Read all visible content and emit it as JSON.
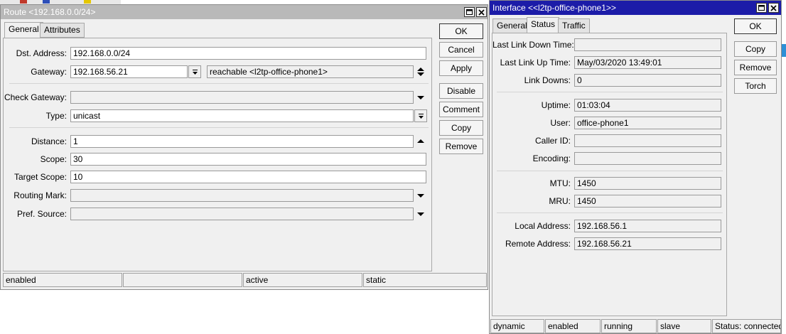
{
  "route_window": {
    "title": "Route <192.168.0.0/24>",
    "tabs": [
      "General",
      "Attributes"
    ],
    "labels": {
      "dst_address": "Dst. Address:",
      "gateway": "Gateway:",
      "check_gateway": "Check Gateway:",
      "type": "Type:",
      "distance": "Distance:",
      "scope": "Scope:",
      "target_scope": "Target Scope:",
      "routing_mark": "Routing Mark:",
      "pref_source": "Pref. Source:"
    },
    "values": {
      "dst_address": "192.168.0.0/24",
      "gateway": "192.168.56.21",
      "gateway_status": "reachable <l2tp-office-phone1>",
      "check_gateway": "",
      "type": "unicast",
      "distance": "1",
      "scope": "30",
      "target_scope": "10",
      "routing_mark": "",
      "pref_source": ""
    },
    "buttons": [
      "OK",
      "Cancel",
      "Apply",
      "Disable",
      "Comment",
      "Copy",
      "Remove"
    ],
    "status_bar": [
      "enabled",
      "",
      "active",
      "static"
    ]
  },
  "interface_window": {
    "title": "Interface <<l2tp-office-phone1>>",
    "tabs": [
      "General",
      "Status",
      "Traffic"
    ],
    "labels": {
      "last_link_down_time": "Last Link Down Time:",
      "last_link_up_time": "Last Link Up Time:",
      "link_downs": "Link Downs:",
      "uptime": "Uptime:",
      "user": "User:",
      "caller_id": "Caller ID:",
      "encoding": "Encoding:",
      "mtu": "MTU:",
      "mru": "MRU:",
      "local_address": "Local Address:",
      "remote_address": "Remote Address:"
    },
    "values": {
      "last_link_down_time": "",
      "last_link_up_time": "May/03/2020 13:49:01",
      "link_downs": "0",
      "uptime": "01:03:04",
      "user": "office-phone1",
      "caller_id": "",
      "encoding": "",
      "mtu": "1450",
      "mru": "1450",
      "local_address": "192.168.56.1",
      "remote_address": "192.168.56.21"
    },
    "buttons": [
      "OK",
      "Copy",
      "Remove",
      "Torch"
    ],
    "status_bar": [
      "dynamic",
      "enabled",
      "running",
      "slave",
      "Status: connected"
    ]
  },
  "colors": {
    "active_title": "#1c1ca8",
    "inactive_title": "#b9b9b9",
    "window_bg": "#f0f0f0"
  }
}
